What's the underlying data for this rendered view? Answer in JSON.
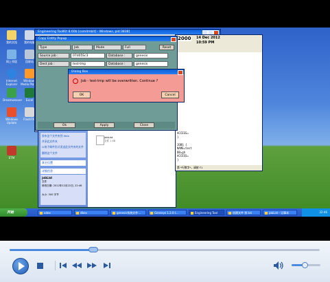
{
  "desktop": {
    "icons": [
      {
        "label": "我的文档",
        "icon": "folder-icon"
      },
      {
        "label": "我的电脑",
        "icon": "computer-icon"
      },
      {
        "label": "网上邻居",
        "icon": "network-icon"
      },
      {
        "label": "回收站",
        "icon": "recycle-bin-icon"
      },
      {
        "label": "Internet Explorer",
        "icon": "browser-icon"
      },
      {
        "label": "Windows Media Player",
        "icon": "media-icon"
      },
      {
        "label": "Dreamweaver",
        "icon": "app-icon"
      },
      {
        "label": "Excel",
        "icon": "excel-icon"
      },
      {
        "label": "Windows Update",
        "icon": "update-icon"
      },
      {
        "label": "FlashFXP",
        "icon": "ftp-icon"
      },
      {
        "label": "ETM",
        "icon": "app-icon"
      }
    ]
  },
  "engineering_window": {
    "title": "Engineering ToolKit 8.60b [com4mbit] - Windows, pid:3838]",
    "clock_year": "2000",
    "clock_line1": "14 Dec 2012",
    "clock_line2": "10:59 PM"
  },
  "copy_popup": {
    "title": "Copy Entity Popup",
    "type_label": "Type",
    "type_value": "Job",
    "mode_label": "Mode",
    "mode_value": "Full",
    "reset_label": "Reset",
    "source_job_label": "Source job :",
    "source_job_value": "07d05Sc3",
    "source_db_label": "Database :",
    "source_db_value": "genesis",
    "dest_job_label": "Dest  job :",
    "dest_job_value": "test-tmp",
    "dest_db_label": "Database :",
    "dest_db_value": "genesis",
    "ok_label": "Ok",
    "apply_label": "Apply",
    "close_label": "Close"
  },
  "dialog": {
    "title": "Dialog Box",
    "message": "Job - test-tmp will be overwritten. Continue ?",
    "ok_label": "OK",
    "cancel_label": "Cancel"
  },
  "editor": {
    "lines": [
      "ACCESS=",
      "}",
      "",
      "JOBS {",
      "  NAME=test",
      "  DB=gh",
      "  ACCESS=",
      "}"
    ],
    "status": "第 *行数字*，请按 F1"
  },
  "explorer": {
    "tasks": [
      "发布这个文件夹到 Web",
      "共享此文件夹",
      "以电子邮件形式发送此文件夹的文件",
      "删除这个文件"
    ],
    "other_places_label": "其它位置",
    "details_label": "详细信息",
    "detail_name": "jobList",
    "detail_type": "文件",
    "detail_modified": "修改日期: 2012年12月22日, 22:46",
    "detail_size": "大小: 300 字节",
    "file_name": "jobList",
    "file_meta": "文件 1 KB"
  },
  "taskbar": {
    "start_label": "开始",
    "items": [
      "odex",
      "dbex",
      "genesis系统文件...",
      "Genesys 1.2.0 I...",
      "Engineering Tool",
      "创建文件 到.txt",
      "jobList - 记事本"
    ],
    "clock": "22:46"
  },
  "player": {
    "progress": 0.27,
    "volume": 0.45,
    "play_icon": "play-icon",
    "stop_icon": "stop-icon",
    "prev_icon": "previous-icon",
    "rewind_icon": "rewind-icon",
    "forward_icon": "fast-forward-icon",
    "next_icon": "next-icon",
    "volume_icon": "speaker-icon"
  },
  "colors": {
    "dialog_bg": "#f49b96",
    "popup_teal": "#6f9c96",
    "xp_blue": "#2457c5"
  }
}
